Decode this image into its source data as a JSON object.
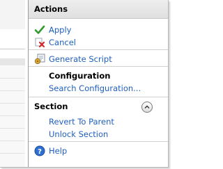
{
  "actions": {
    "header": "Actions",
    "apply": "Apply",
    "cancel": "Cancel",
    "generate_script": "Generate Script",
    "configuration_heading": "Configuration",
    "search_configuration": "Search Configuration..."
  },
  "section": {
    "header": "Section",
    "revert_to_parent": "Revert To Parent",
    "unlock_section": "Unlock Section"
  },
  "help": "Help",
  "colors": {
    "link": "#1f5fbf",
    "header_bg": "#e6e6e6",
    "divider": "#d0d0d0"
  },
  "icons": [
    "checkmark-icon",
    "cancel-x-icon",
    "generate-script-icon",
    "collapse-chevron-icon",
    "help-icon"
  ]
}
